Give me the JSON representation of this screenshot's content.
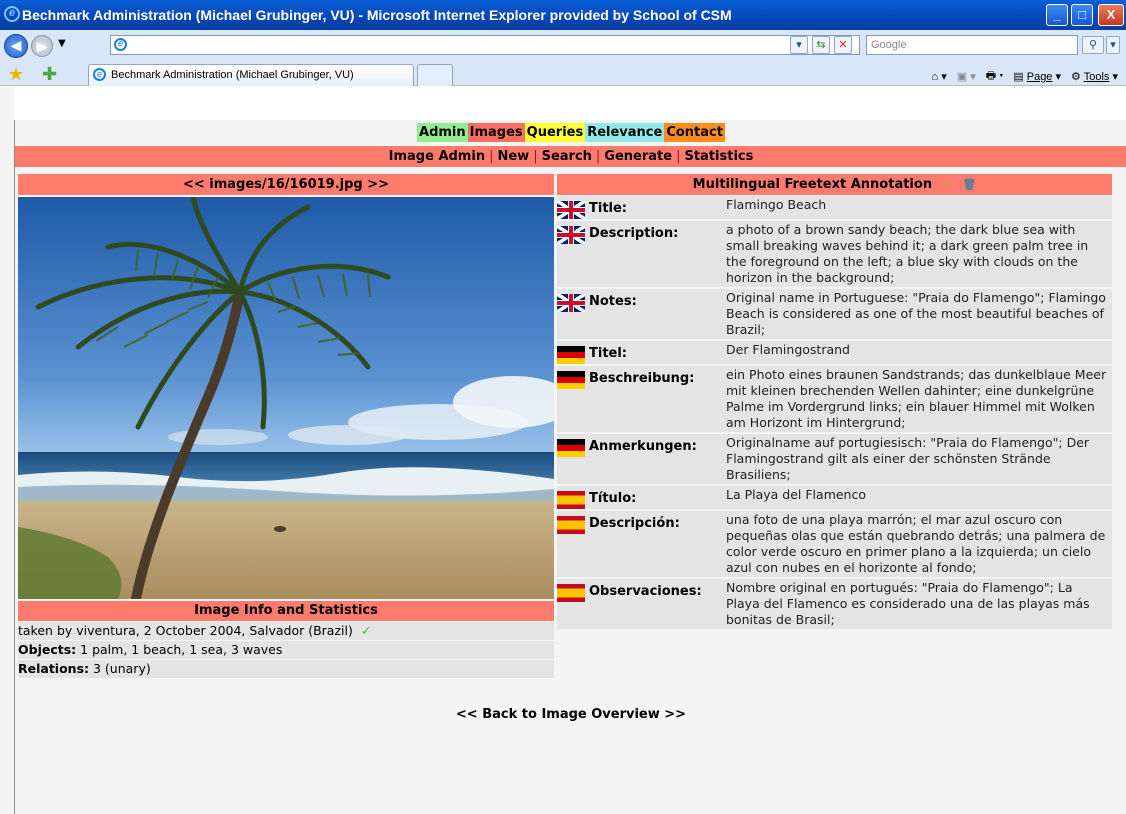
{
  "window": {
    "title": "Bechmark Administration (Michael Grubinger, VU) - Microsoft Internet Explorer provided by School of CSM",
    "controls": {
      "minimize": "_",
      "maximize": "□",
      "close": "X"
    }
  },
  "browser": {
    "url": "",
    "search_placeholder": "Google",
    "tab_title": "Bechmark Administration (Michael Grubinger, VU)",
    "tools": {
      "page": "Page",
      "tools": "Tools"
    }
  },
  "menu": {
    "items": [
      {
        "label": "Admin",
        "color": "#90ee90"
      },
      {
        "label": "Images",
        "color": "#ff6f61"
      },
      {
        "label": "Queries",
        "color": "#ffff33"
      },
      {
        "label": "Relevance",
        "color": "#90e8e8"
      },
      {
        "label": "Contact",
        "color": "#ff8c1a"
      }
    ]
  },
  "submenu": {
    "items": [
      "Image Admin",
      "New",
      "Search",
      "Generate",
      "Statistics"
    ]
  },
  "image": {
    "header": "<< images/16/16019.jpg >>"
  },
  "info": {
    "header": "Image Info and Statistics",
    "taken": "taken by viventura, 2 October 2004, Salvador (Brazil)",
    "objects_label": "Objects:",
    "objects": "1 palm, 1 beach, 1 sea, 3 waves",
    "relations_label": "Relations:",
    "relations": "3 (unary)"
  },
  "annotation": {
    "header": "Multilingual Freetext Annotation",
    "rows": [
      {
        "flag": "uk",
        "label": "Title:",
        "value": "Flamingo Beach"
      },
      {
        "flag": "uk",
        "label": "Description:",
        "value": "a photo of a brown sandy beach; the dark blue sea with small breaking waves behind it; a dark green palm tree in the foreground on the left; a blue sky with clouds on the horizon in the background;"
      },
      {
        "flag": "uk",
        "label": "Notes:",
        "value": "Original name in Portuguese: \"Praia do Flamengo\"; Flamingo Beach is considered as one of the most beautiful beaches of Brazil;"
      },
      {
        "flag": "de",
        "label": "Titel:",
        "value": "Der Flamingostrand"
      },
      {
        "flag": "de",
        "label": "Beschreibung:",
        "value": "ein Photo eines braunen Sandstrands; das dunkelblaue Meer mit kleinen brechenden Wellen dahinter; eine dunkelgrüne Palme im Vordergrund links; ein blauer Himmel mit Wolken am Horizont im Hintergrund;"
      },
      {
        "flag": "de",
        "label": "Anmerkungen:",
        "value": "Originalname auf portugiesisch: \"Praia do Flamengo\"; Der Flamingostrand gilt als einer der schönsten Strände Brasiliens;"
      },
      {
        "flag": "es",
        "label": "Título:",
        "value": "La Playa del Flamenco"
      },
      {
        "flag": "es",
        "label": "Descripción:",
        "value": "una foto de una playa marrón; el mar azul oscuro con pequeñas olas que están quebrando detrás; una palmera de color verde oscuro en primer plano a la izquierda; un cielo azul con nubes en el horizonte al fondo;"
      },
      {
        "flag": "es",
        "label": "Observaciones:",
        "value": "Nombre original en portugués: \"Praia do Flamengo\"; La Playa del Flamenco es considerado una de las playas más bonitas de Brasil;"
      }
    ]
  },
  "footer": {
    "back_link": "<< Back to Image Overview >>"
  }
}
